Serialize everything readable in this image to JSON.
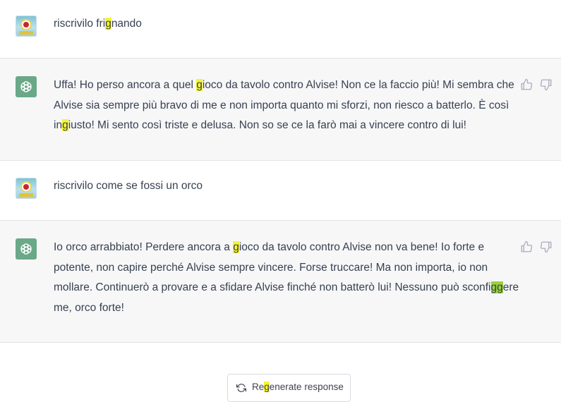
{
  "messages": [
    {
      "role": "user",
      "avatar": "user-avatar",
      "parts": [
        {
          "t": "riscrivilo fri"
        },
        {
          "t": "g",
          "hl": "#f5f531"
        },
        {
          "t": "nando"
        }
      ]
    },
    {
      "role": "assistant",
      "avatar": "openai-logo-icon",
      "parts": [
        {
          "t": "Uffa! Ho perso ancora a quel "
        },
        {
          "t": "g",
          "hl": "#f5f531"
        },
        {
          "t": "ioco da tavolo contro Alvise! Non ce la faccio più! Mi sembra che Alvise sia sempre più bravo di me e non importa quanto mi sforzi, non riesco a batterlo. È così in"
        },
        {
          "t": "g",
          "hl": "#f5f531"
        },
        {
          "t": "iusto! Mi sento così triste e delusa. Non so se ce la farò mai a vincere contro di lui!"
        }
      ]
    },
    {
      "role": "user",
      "avatar": "user-avatar",
      "parts": [
        {
          "t": "riscrivilo come se fossi un orco"
        }
      ]
    },
    {
      "role": "assistant",
      "avatar": "openai-logo-icon",
      "parts": [
        {
          "t": "Io orco arrabbiato! Perdere ancora a "
        },
        {
          "t": "g",
          "hl": "#f5f531"
        },
        {
          "t": "ioco da tavolo contro Alvise non va bene! Io forte e potente, non capire perché Alvise sempre vincere. Forse truccare! Ma non importa, io non mollare. Continuerò a provare e a sfidare Alvise finché non batterò lui! Nessuno può sconfi"
        },
        {
          "t": "gg",
          "hl": "#9ad13f"
        },
        {
          "t": "ere me, orco forte!"
        }
      ]
    }
  ],
  "actions": {
    "thumbs_up_icon": "thumbs-up-icon",
    "thumbs_down_icon": "thumbs-down-icon"
  },
  "regenerate": {
    "icon": "refresh-icon",
    "parts": [
      {
        "t": "Re"
      },
      {
        "t": "g",
        "hl": "#f5f531"
      },
      {
        "t": "enerate response"
      }
    ]
  },
  "colors": {
    "assistant_bg": "#f7f7f8",
    "user_bg": "#ffffff",
    "highlight_yellow": "#f5f531",
    "highlight_green": "#9ad13f",
    "gpt_avatar": "#6aa888"
  }
}
